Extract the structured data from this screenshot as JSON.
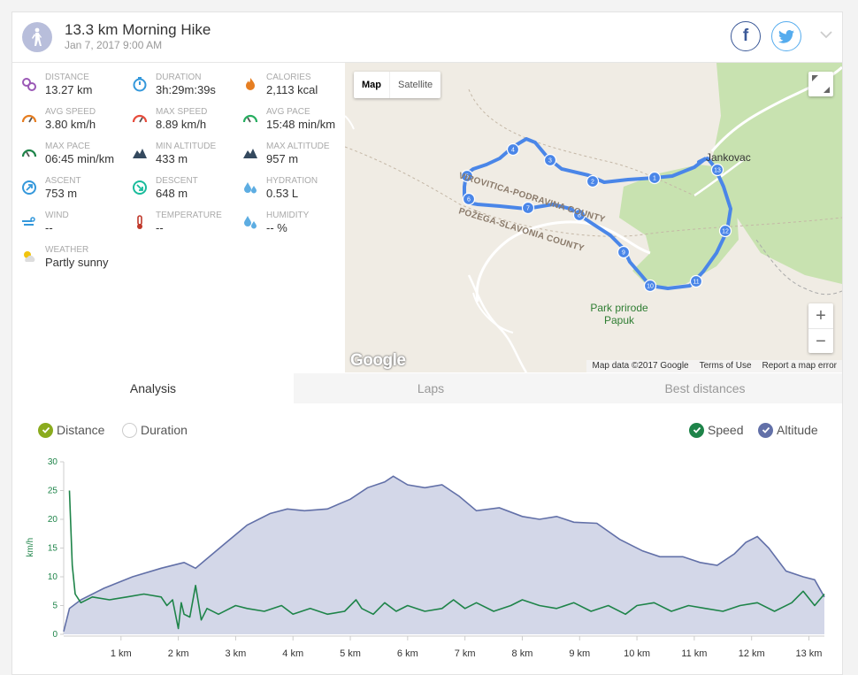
{
  "header": {
    "title": "13.3 km Morning Hike",
    "date": "Jan 7, 2017 9:00 AM",
    "activity_icon": "hiking-person-icon",
    "social": [
      "facebook-icon",
      "twitter-icon"
    ],
    "colors": {
      "facebook": "#3b5998",
      "twitter": "#55acee"
    }
  },
  "stats": [
    {
      "label": "Distance",
      "value": "13.27 km",
      "icon": "distance-icon",
      "color": "#9b59b6"
    },
    {
      "label": "Duration",
      "value": "3h:29m:39s",
      "icon": "stopwatch-icon",
      "color": "#3498db"
    },
    {
      "label": "Calories",
      "value": "2,113 kcal",
      "icon": "flame-icon",
      "color": "#e67e22"
    },
    {
      "label": "Avg speed",
      "value": "3.80 km/h",
      "icon": "speedometer-icon",
      "color": "#e67e22"
    },
    {
      "label": "Max speed",
      "value": "8.89 km/h",
      "icon": "speedometer-icon",
      "color": "#e74c3c"
    },
    {
      "label": "Avg pace",
      "value": "15:48 min/km",
      "icon": "pace-icon",
      "color": "#27ae60"
    },
    {
      "label": "Max pace",
      "value": "06:45 min/km",
      "icon": "pace-icon",
      "color": "#1e8449"
    },
    {
      "label": "Min altitude",
      "value": "433 m",
      "icon": "mountain-icon",
      "color": "#34495e"
    },
    {
      "label": "Max altitude",
      "value": "957 m",
      "icon": "mountain-icon",
      "color": "#34495e"
    },
    {
      "label": "Ascent",
      "value": "753 m",
      "icon": "ascent-icon",
      "color": "#3498db"
    },
    {
      "label": "Descent",
      "value": "648 m",
      "icon": "descent-icon",
      "color": "#1abc9c"
    },
    {
      "label": "Hydration",
      "value": "0.53 L",
      "icon": "water-drops-icon",
      "color": "#5dade2"
    },
    {
      "label": "Wind",
      "value": "--",
      "icon": "wind-icon",
      "color": "#3498db"
    },
    {
      "label": "Temperature",
      "value": "--",
      "icon": "thermometer-icon",
      "color": "#c0392b"
    },
    {
      "label": "Humidity",
      "value": "-- %",
      "icon": "humidity-icon",
      "color": "#5dade2"
    },
    {
      "label": "Weather",
      "value": "Partly sunny",
      "icon": "partly-sunny-icon",
      "color": "#f1c40f"
    }
  ],
  "map": {
    "type_buttons": [
      "Map",
      "Satellite"
    ],
    "active_type": "Map",
    "labels": {
      "county1": "VIROVITICA-PODRAVINA COUNTY",
      "county2": "POŽEGA-SLAVONIA COUNTY",
      "park": "Park prirode",
      "park2": "Papuk",
      "town": "Jankovac"
    },
    "waypoints": [
      "1",
      "2",
      "3",
      "4",
      "5",
      "6",
      "7",
      "8",
      "9",
      "10",
      "11",
      "12",
      "13"
    ],
    "zoom_in": "+",
    "zoom_out": "−",
    "logo": "Google",
    "attribution": [
      "Map data ©2017 Google",
      "Terms of Use",
      "Report a map error"
    ],
    "route_color": "#4a86e8"
  },
  "tabs": [
    "Analysis",
    "Laps",
    "Best distances"
  ],
  "active_tab": "Analysis",
  "x_mode": {
    "options": [
      "Distance",
      "Duration"
    ],
    "selected": "Distance"
  },
  "series_toggles": [
    {
      "name": "Speed",
      "checked": true,
      "color": "#1e8449"
    },
    {
      "name": "Altitude",
      "checked": true,
      "color": "#6270a8"
    }
  ],
  "chart_data": {
    "type": "line",
    "ylabel": "km/h",
    "ylim": [
      0,
      30
    ],
    "yticks": [
      0,
      5,
      10,
      15,
      20,
      25,
      30
    ],
    "xlim": [
      0,
      13.27
    ],
    "xticks": [
      1,
      2,
      3,
      4,
      5,
      6,
      7,
      8,
      9,
      10,
      11,
      12,
      13
    ],
    "xtick_labels": [
      "1 km",
      "2 km",
      "3 km",
      "4 km",
      "5 km",
      "6 km",
      "7 km",
      "8 km",
      "9 km",
      "10 km",
      "11 km",
      "12 km",
      "13 km"
    ],
    "series": [
      {
        "name": "Altitude",
        "style": "area",
        "color": "#6270a8",
        "fill": "#d3d7e8",
        "x": [
          0,
          0.1,
          0.3,
          0.7,
          1.2,
          1.7,
          2.1,
          2.3,
          2.6,
          2.9,
          3.2,
          3.6,
          3.9,
          4.2,
          4.6,
          5.0,
          5.3,
          5.6,
          5.75,
          6.0,
          6.3,
          6.6,
          6.9,
          7.2,
          7.6,
          8.0,
          8.3,
          8.6,
          8.9,
          9.3,
          9.7,
          10.1,
          10.4,
          10.8,
          11.1,
          11.4,
          11.7,
          11.9,
          12.1,
          12.3,
          12.6,
          12.9,
          13.1,
          13.27
        ],
        "y": [
          0.5,
          4.5,
          6.0,
          8.0,
          10.0,
          11.5,
          12.5,
          11.5,
          14.0,
          16.5,
          19.0,
          21.0,
          21.8,
          21.5,
          21.8,
          23.5,
          25.5,
          26.5,
          27.5,
          26.0,
          25.5,
          26.0,
          24.0,
          21.5,
          22.0,
          20.5,
          20.0,
          20.5,
          19.5,
          19.3,
          16.5,
          14.5,
          13.5,
          13.5,
          12.5,
          12.0,
          14.0,
          16.0,
          17.0,
          15.0,
          11.0,
          10.0,
          9.5,
          6.5
        ]
      },
      {
        "name": "Speed",
        "style": "line",
        "color": "#1e8449",
        "x": [
          0.1,
          0.15,
          0.2,
          0.3,
          0.5,
          0.8,
          1.1,
          1.4,
          1.7,
          1.8,
          1.9,
          2.0,
          2.05,
          2.1,
          2.2,
          2.3,
          2.4,
          2.5,
          2.7,
          3.0,
          3.2,
          3.5,
          3.8,
          4.0,
          4.3,
          4.6,
          4.9,
          5.1,
          5.2,
          5.4,
          5.6,
          5.8,
          6.0,
          6.3,
          6.6,
          6.8,
          7.0,
          7.2,
          7.5,
          7.8,
          8.0,
          8.3,
          8.6,
          8.9,
          9.2,
          9.5,
          9.8,
          10.0,
          10.3,
          10.6,
          10.9,
          11.2,
          11.5,
          11.8,
          12.1,
          12.4,
          12.7,
          12.9,
          13.1,
          13.27
        ],
        "y": [
          25.0,
          12.0,
          7.0,
          5.5,
          6.5,
          6.0,
          6.5,
          7.0,
          6.5,
          5.0,
          6.0,
          1.0,
          5.5,
          3.5,
          3.0,
          8.5,
          2.5,
          4.5,
          3.5,
          5.0,
          4.5,
          4.0,
          5.0,
          3.5,
          4.5,
          3.5,
          4.0,
          6.0,
          4.5,
          3.5,
          5.5,
          4.0,
          5.0,
          4.0,
          4.5,
          6.0,
          4.5,
          5.5,
          4.0,
          5.0,
          6.0,
          5.0,
          4.5,
          5.5,
          4.0,
          5.0,
          3.5,
          5.0,
          5.5,
          4.0,
          5.0,
          4.5,
          4.0,
          5.0,
          5.5,
          4.0,
          5.5,
          7.5,
          5.0,
          7.0
        ]
      }
    ]
  }
}
